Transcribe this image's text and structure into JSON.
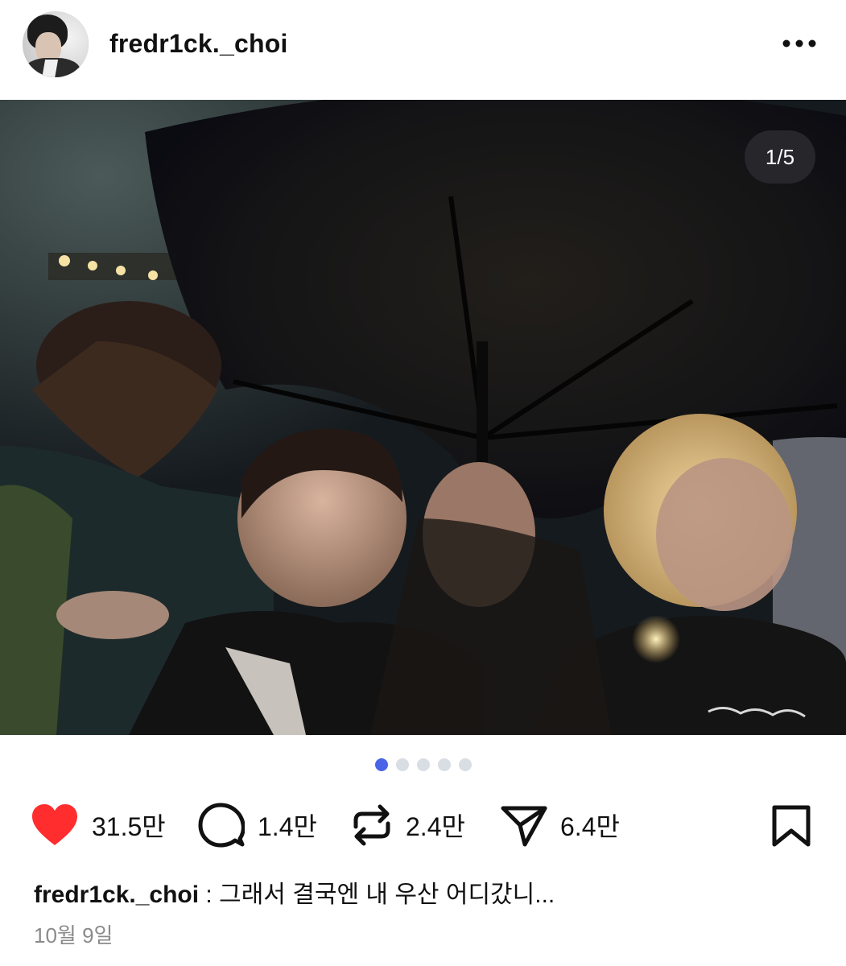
{
  "post": {
    "username": "fredr1ck._choi",
    "more_icon": "more-horizontal-icon",
    "carousel": {
      "position_text": "1/5",
      "current_index": 1,
      "total": 5
    },
    "photo_description_icon": "photo",
    "actions": {
      "like": {
        "icon": "heart-filled-icon",
        "count": "31.5만",
        "color": "#ff2d2d"
      },
      "comment": {
        "icon": "comment-bubble-icon",
        "count": "1.4만"
      },
      "repost": {
        "icon": "repost-arrows-icon",
        "count": "2.4만"
      },
      "share": {
        "icon": "paper-plane-icon",
        "count": "6.4만"
      },
      "save": {
        "icon": "bookmark-icon"
      }
    },
    "caption": {
      "username": "fredr1ck._choi",
      "separator": " : ",
      "text": "그래서 결국엔 내 우산 어디갔니..."
    },
    "date": "10월 9일"
  },
  "colors": {
    "accent_dot": "#4a64e8",
    "inactive_dot": "#d9dde4",
    "like_red": "#ff2d2d"
  }
}
